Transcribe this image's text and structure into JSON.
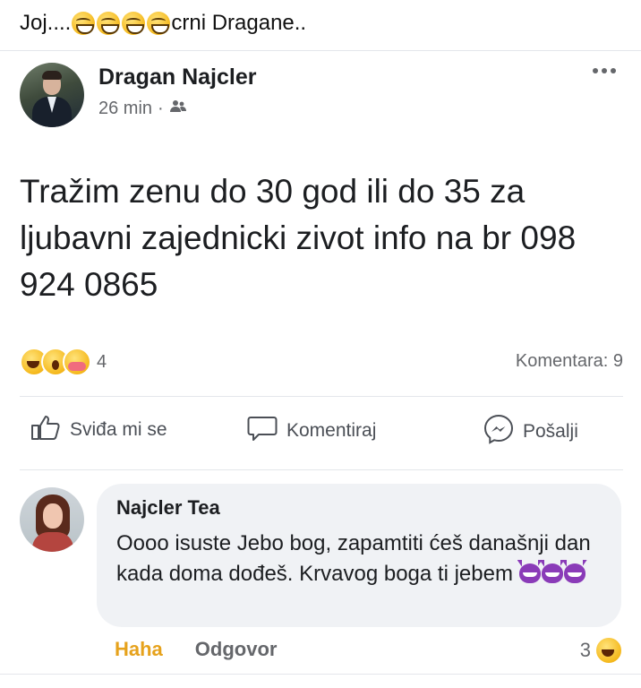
{
  "caption": {
    "prefix": "Joj....",
    "suffix": "crni Dragane..",
    "emoji_count": 4,
    "emoji_icon": "grinning-face-icon"
  },
  "post": {
    "author": "Dragan Najcler",
    "time": "26 min",
    "separator": "·",
    "audience_icon": "friends-icon",
    "text": "Tražim zenu do 30 god ili do 35 za ljubavni zajednicki zivot info na br 098 924 0865",
    "reactions": {
      "icons": [
        "haha-reaction-icon",
        "wow-reaction-icon",
        "care-reaction-icon"
      ],
      "count": "4"
    },
    "comments_count": "Komentara: 9"
  },
  "actions": {
    "like": "Sviđa mi se",
    "comment": "Komentiraj",
    "share": "Pošalji"
  },
  "comment": {
    "author": "Najcler Tea",
    "text": "Oooo isuste Jebo bog, zapamtiti ćeš današnji dan kada doma dođeš. Krvavog boga ti jebem",
    "emoji_icon": "smiling-devil-icon",
    "emoji_count": 3,
    "haha_label": "Haha",
    "reply_label": "Odgovor",
    "reaction_count": "3"
  },
  "colors": {
    "secondary_text": "#65676b",
    "bubble": "#f0f2f5",
    "haha_label": "#e6a21c"
  }
}
